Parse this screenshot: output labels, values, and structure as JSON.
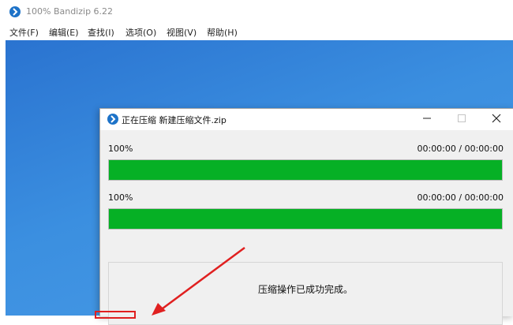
{
  "app": {
    "title": "100% Bandizip 6.22",
    "logo": "bandizip-logo-icon",
    "colors": {
      "accent": "#1e73c8",
      "desktop": "#3b8fe0"
    }
  },
  "menu": {
    "items": [
      {
        "label": "文件(F)"
      },
      {
        "label": "编辑(E)"
      },
      {
        "label": "查找(I)"
      },
      {
        "label": "选项(O)"
      },
      {
        "label": "视图(V)"
      },
      {
        "label": "帮助(H)"
      }
    ]
  },
  "dialog": {
    "title": "正在压缩 新建压缩文件.zip",
    "minimize_icon": "minimize-icon",
    "maximize_icon": "maximize-icon",
    "close_icon": "close-icon",
    "progress": [
      {
        "percent_label": "100%",
        "time_label": "00:00:00 / 00:00:00",
        "value": 1.0
      },
      {
        "percent_label": "100%",
        "time_label": "00:00:00 / 00:00:00",
        "value": 1.0
      }
    ],
    "progress_color": "#06b025",
    "message": "压缩操作已成功完成。"
  },
  "annotation": {
    "arrow_color": "#e02020"
  }
}
